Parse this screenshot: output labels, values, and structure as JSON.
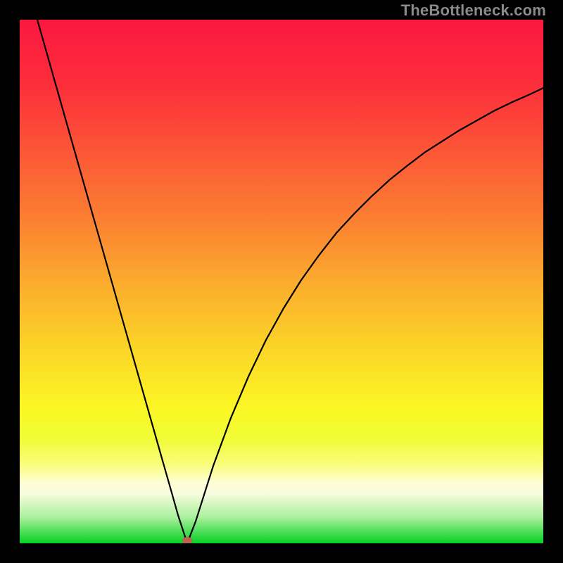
{
  "watermark": "TheBottleneck.com",
  "colors": {
    "gradient_stops": [
      {
        "offset": 0.0,
        "color": "#fb183f"
      },
      {
        "offset": 0.12,
        "color": "#fc2d3b"
      },
      {
        "offset": 0.25,
        "color": "#fc5636"
      },
      {
        "offset": 0.38,
        "color": "#fb7f32"
      },
      {
        "offset": 0.5,
        "color": "#fbab2d"
      },
      {
        "offset": 0.62,
        "color": "#fbd228"
      },
      {
        "offset": 0.74,
        "color": "#fbf624"
      },
      {
        "offset": 0.8,
        "color": "#f1fc35"
      },
      {
        "offset": 0.85,
        "color": "#fafd7e"
      },
      {
        "offset": 0.885,
        "color": "#fefed7"
      },
      {
        "offset": 0.905,
        "color": "#f7fcde"
      },
      {
        "offset": 0.95,
        "color": "#abf09d"
      },
      {
        "offset": 0.975,
        "color": "#56e05f"
      },
      {
        "offset": 1.0,
        "color": "#05d125"
      }
    ],
    "frame": "#000000",
    "curve": "#000000",
    "dot": "#c1604e"
  },
  "chart_data": {
    "type": "line",
    "title": "",
    "xlabel": "",
    "ylabel": "",
    "xlim": [
      0,
      100
    ],
    "ylim": [
      0,
      100
    ],
    "optimum": {
      "x": 31,
      "y": 0
    },
    "dot": {
      "x": 32,
      "y": 0
    },
    "series": [
      {
        "name": "bottleneck-curve",
        "x": [
          3.36,
          6.72,
          10.08,
          13.44,
          16.8,
          20.16,
          23.52,
          26.88,
          28.76,
          30.24,
          31.99,
          33.6,
          36.96,
          40.32,
          43.68,
          47.04,
          50.4,
          53.76,
          57.12,
          60.48,
          63.84,
          67.2,
          70.56,
          73.92,
          77.28,
          80.64,
          84.01,
          87.37,
          90.73,
          94.09,
          97.45,
          100.0
        ],
        "y": [
          100.0,
          88.17,
          76.34,
          64.52,
          52.69,
          40.86,
          29.03,
          17.2,
          10.62,
          5.38,
          0.0,
          4.17,
          14.78,
          23.92,
          31.85,
          38.84,
          44.89,
          50.27,
          54.97,
          59.27,
          62.9,
          66.26,
          69.35,
          72.04,
          74.6,
          76.75,
          78.9,
          80.78,
          82.66,
          84.27,
          85.75,
          86.96
        ]
      }
    ]
  }
}
